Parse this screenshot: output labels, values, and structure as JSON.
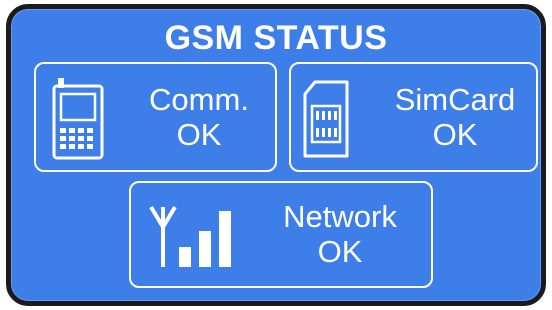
{
  "title": "GSM STATUS",
  "colors": {
    "panel_background": "#3d7ee8",
    "panel_border": "#1b1b1f",
    "foreground": "#ffffff"
  },
  "status_cards": {
    "comm": {
      "icon": "mobile-phone-icon",
      "label": "Comm.",
      "status": "OK"
    },
    "simcard": {
      "icon": "sim-card-icon",
      "label": "SimCard",
      "status": "OK"
    },
    "network": {
      "icon": "signal-strength-icon",
      "label": "Network",
      "status": "OK"
    }
  }
}
